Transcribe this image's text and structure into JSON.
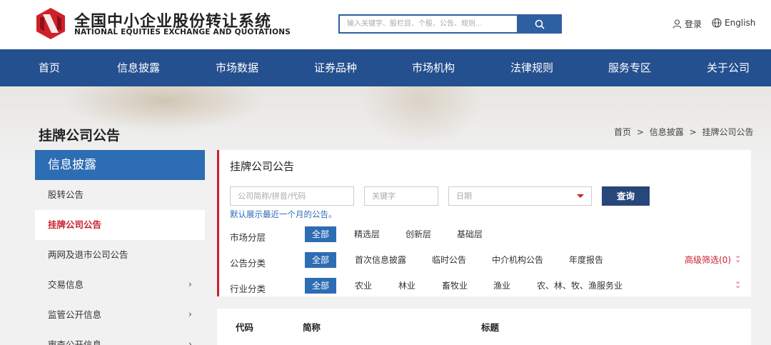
{
  "header": {
    "logo_cn": "全国中小企业股份转让系统",
    "logo_en": "NATIONAL EQUITIES EXCHANGE AND QUOTATIONS",
    "search_placeholder": "输入关键字、股栏目、个股、公告、规则...",
    "login_label": "登录",
    "lang_label": "English"
  },
  "nav": [
    "首页",
    "信息披露",
    "市场数据",
    "证券品种",
    "市场机构",
    "法律规则",
    "服务专区",
    "关于公司"
  ],
  "page": {
    "title": "挂牌公司公告",
    "breadcrumb": [
      "首页",
      "信息披露",
      "挂牌公司公告"
    ],
    "breadcrumb_sep": ">"
  },
  "sidebar": {
    "heading": "信息披露",
    "items": [
      {
        "label": "股转公告",
        "chevron": false
      },
      {
        "label": "挂牌公司公告",
        "chevron": false,
        "active": true
      },
      {
        "label": "两网及退市公司公告",
        "chevron": false
      },
      {
        "label": "交易信息",
        "chevron": true
      },
      {
        "label": "监管公开信息",
        "chevron": true
      },
      {
        "label": "审查公开信息",
        "chevron": true
      }
    ]
  },
  "main": {
    "title": "挂牌公司公告",
    "code_placeholder": "公司简称/拼音/代码",
    "keyword_placeholder": "关键字",
    "date_placeholder": "日期",
    "query_label": "查询",
    "hint": "默认展示最近一个月的公告。",
    "filters": [
      {
        "label": "市场分层",
        "options": [
          "全部",
          "精选层",
          "创新层",
          "基础层"
        ]
      },
      {
        "label": "公告分类",
        "options": [
          "全部",
          "首次信息披露",
          "临时公告",
          "中介机构公告",
          "年度报告"
        ]
      },
      {
        "label": "行业分类",
        "options": [
          "全部",
          "农业",
          "林业",
          "畜牧业",
          "渔业",
          "农、林、牧、渔服务业"
        ]
      }
    ],
    "advanced_filter": "高级筛选(0)"
  },
  "table": {
    "columns": [
      "代码",
      "简称",
      "标题"
    ]
  },
  "colors": {
    "brand_blue": "#25508f",
    "accent_blue": "#2d6db3",
    "accent_red": "#c8202c"
  }
}
